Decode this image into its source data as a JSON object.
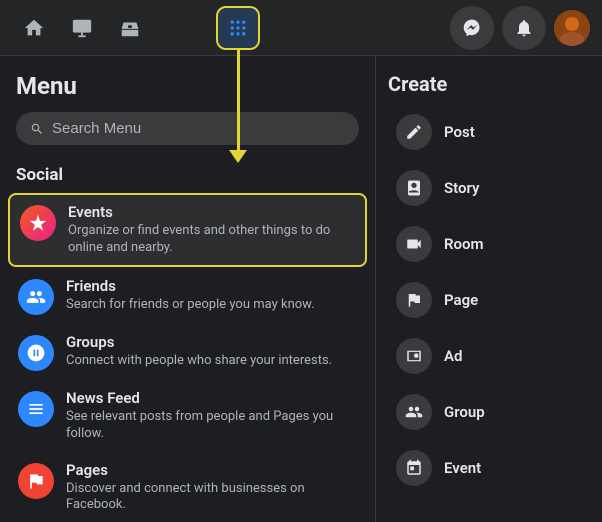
{
  "topbar": {
    "nav_icons": [
      {
        "name": "home-icon",
        "symbol": "⌂"
      },
      {
        "name": "watch-icon",
        "symbol": "▣"
      },
      {
        "name": "marketplace-icon",
        "symbol": "❏"
      }
    ],
    "grid_icon": "⠿",
    "messenger_icon": "💬",
    "notification_icon": "🔔"
  },
  "menu": {
    "title": "Menu",
    "search_placeholder": "Search Menu"
  },
  "social": {
    "section_label": "Social",
    "items": [
      {
        "name": "Events",
        "description": "Organize or find events and other things to do online and nearby.",
        "icon_type": "events",
        "highlighted": true
      },
      {
        "name": "Friends",
        "description": "Search for friends or people you may know.",
        "icon_type": "friends",
        "highlighted": false
      },
      {
        "name": "Groups",
        "description": "Connect with people who share your interests.",
        "icon_type": "groups",
        "highlighted": false
      },
      {
        "name": "News Feed",
        "description": "See relevant posts from people and Pages you follow.",
        "icon_type": "newsfeed",
        "highlighted": false
      },
      {
        "name": "Pages",
        "description": "Discover and connect with businesses on Facebook.",
        "icon_type": "pages",
        "highlighted": false
      }
    ]
  },
  "create": {
    "title": "Create",
    "items": [
      {
        "name": "Post",
        "icon": "✏️"
      },
      {
        "name": "Story",
        "icon": "📖"
      },
      {
        "name": "Room",
        "icon": "➕"
      },
      {
        "name": "Page",
        "icon": "🚩"
      },
      {
        "name": "Ad",
        "icon": "📣"
      },
      {
        "name": "Group",
        "icon": "👥"
      },
      {
        "name": "Event",
        "icon": "➕"
      }
    ]
  }
}
